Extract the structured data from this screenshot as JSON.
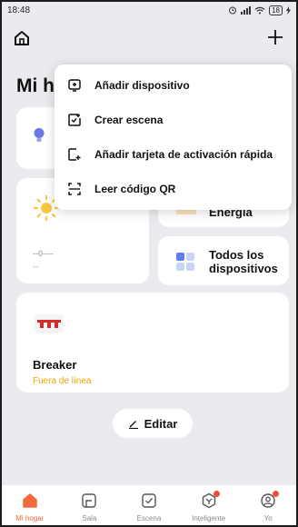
{
  "statusbar": {
    "time": "18:48",
    "battery": "18"
  },
  "header": {
    "title": "Mi h",
    "home_icon": "home-icon",
    "add_icon": "plus-icon"
  },
  "menu": {
    "items": [
      {
        "label": "Añadir dispositivo",
        "icon": "add-device-icon"
      },
      {
        "label": "Crear escena",
        "icon": "create-scene-icon"
      },
      {
        "label": "Añadir tarjeta de activación rápida",
        "icon": "quick-card-icon"
      },
      {
        "label": "Leer código QR",
        "icon": "scan-qr-icon"
      }
    ]
  },
  "cards": {
    "weather": {
      "line1": "--0----",
      "line2": "--"
    },
    "energy": {
      "label": "Energía"
    },
    "all_devices": {
      "label": "Todos los dispositivos"
    },
    "device": {
      "name": "Breaker",
      "status": "Fuera de línea",
      "status_color": "#f0a500"
    }
  },
  "edit_button": {
    "label": "Editar"
  },
  "bottom_nav": {
    "items": [
      {
        "label": "Mi hogar",
        "icon": "home-tab-icon",
        "active": true
      },
      {
        "label": "Sala",
        "icon": "room-tab-icon",
        "active": false
      },
      {
        "label": "Escena",
        "icon": "scene-tab-icon",
        "active": false
      },
      {
        "label": "Inteligente",
        "icon": "smart-tab-icon",
        "active": false,
        "badge": true
      },
      {
        "label": "Yo",
        "icon": "me-tab-icon",
        "active": false,
        "badge": true
      }
    ]
  },
  "colors": {
    "accent": "#f26a3b",
    "background": "#e9ebee",
    "badge": "#ee4e35"
  }
}
